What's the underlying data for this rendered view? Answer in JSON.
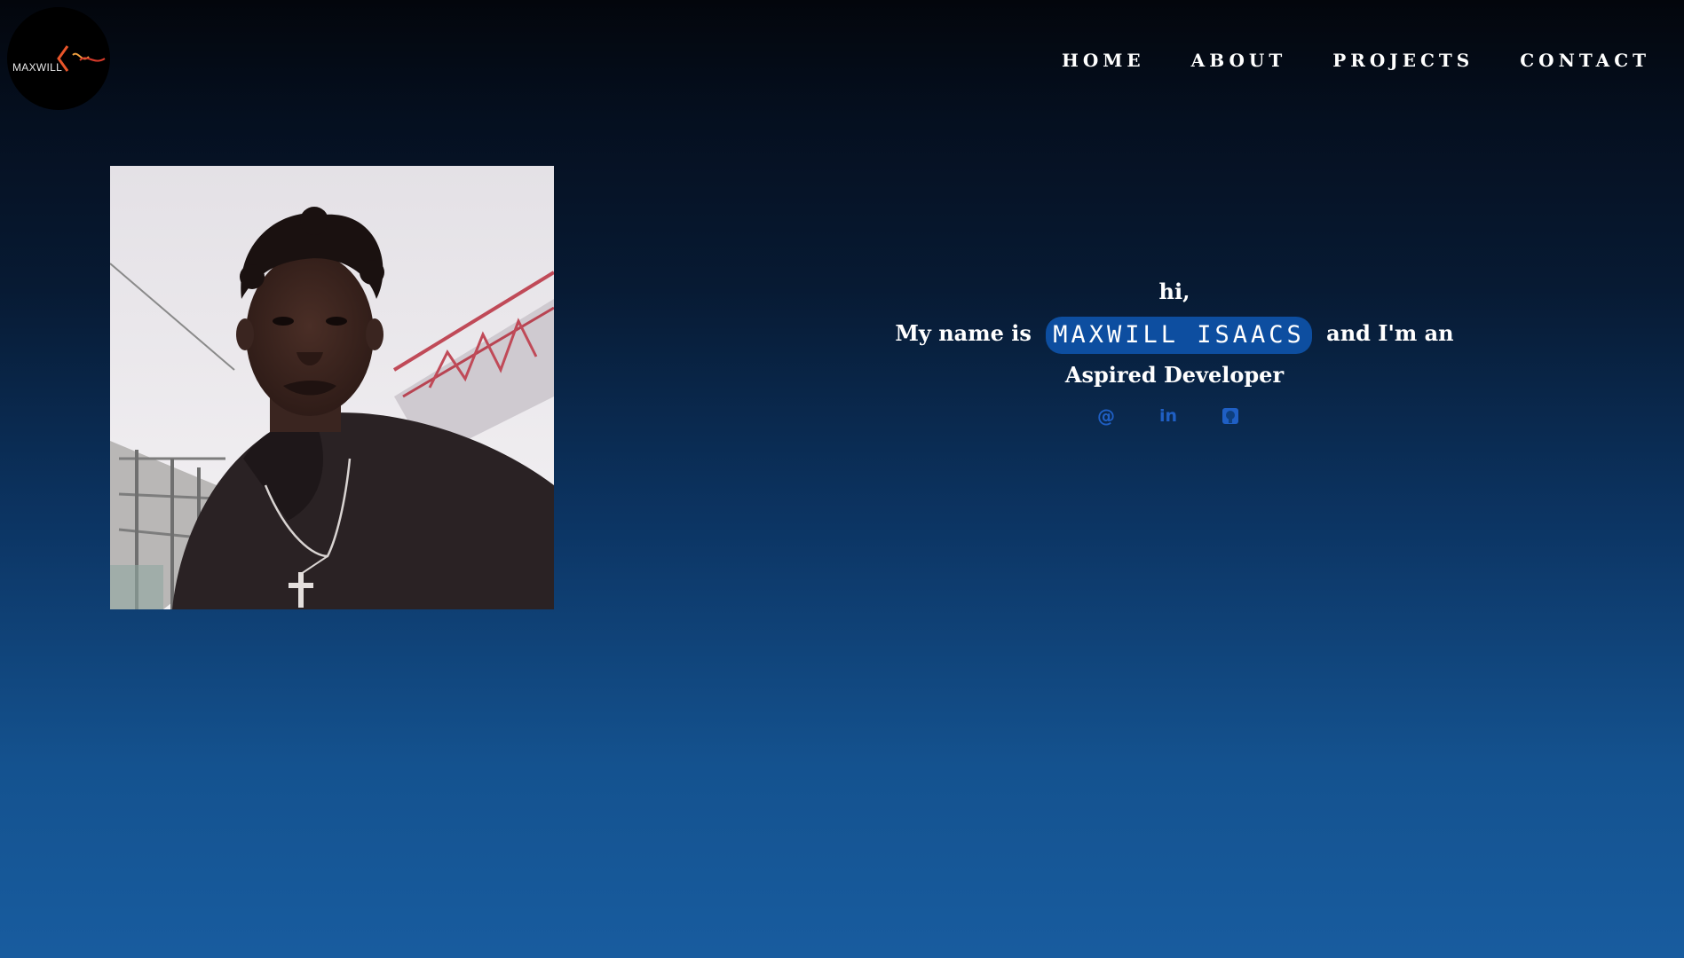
{
  "logo": {
    "text": "MAXWILL"
  },
  "nav": {
    "items": [
      {
        "label": "HOME"
      },
      {
        "label": "ABOUT"
      },
      {
        "label": "PROJECTS"
      },
      {
        "label": "CONTACT"
      }
    ]
  },
  "hero": {
    "greeting": "hi,",
    "intro_prefix": "My name is",
    "name": "MAXWILL ISAACS",
    "intro_suffix": "and I'm an",
    "role": "Aspired Developer"
  },
  "socials": [
    {
      "icon": "email-icon",
      "glyph": "@"
    },
    {
      "icon": "linkedin-icon",
      "glyph": "in"
    },
    {
      "icon": "github-icon",
      "glyph": ""
    }
  ],
  "colors": {
    "accent": "#0d4ea0",
    "social_icons": "#1f5fc4",
    "nav_text": "#ffffff"
  }
}
